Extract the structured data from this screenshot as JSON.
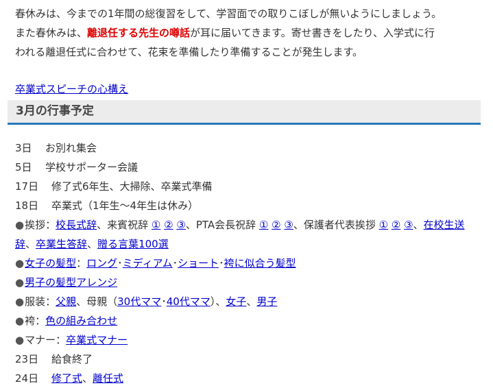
{
  "intro": {
    "line1": "春休みは、今までの1年間の総復習をして、学習面での取りこぼしが無いようにしましょう。",
    "line2_pre": "また春休みは、",
    "line2_em": "離退任する先生の噂話",
    "line2_post": "が耳に届いてきます。寄せ書きをしたり、入学式に行",
    "line3": "われる離退任式に合わせて、花束を準備したり準備することが発生します。"
  },
  "speech_link": "卒業式スピーチの心構え",
  "heading": "3月の行事予定",
  "schedule": {
    "d3": {
      "day": "3日",
      "text": "お別れ集会"
    },
    "d5": {
      "day": "5日",
      "text": "学校サポーター会議"
    },
    "d17": {
      "day": "17日",
      "text": "修了式6年生、大掃除、卒業式準備"
    },
    "d18": {
      "day": "18日",
      "text": "卒業式（1年生～4年生は休み）"
    },
    "greetings": {
      "bullet": "●",
      "label": "挨拶：",
      "principal": "校長式辞",
      "guest": "、来賓祝辞 ",
      "n1": "①",
      "n2": "②",
      "n3": "③",
      "pta": "、PTA会長祝辞 ",
      "parent": "、保護者代表挨拶 ",
      "student_send": "在校生送辞",
      "graduate": "卒業生答辞",
      "words": "贈る言葉100選",
      "comma": "、"
    },
    "girls_hair": {
      "bullet": "●",
      "link": "女子の髪型",
      "colon": "：",
      "long": "ロング",
      "medium": "ミディアム",
      "short": "ショート",
      "hakama": "袴に似合う髪型",
      "dot": "･"
    },
    "boys_hair": {
      "bullet": "●",
      "link": "男子の髪型アレンジ"
    },
    "clothes": {
      "bullet": "●",
      "label": "服装：",
      "father": "父親",
      "mother": "、母親（",
      "m30": "30代ママ",
      "dot": "･",
      "m40": "40代ママ",
      "close": "）、",
      "girls": "女子",
      "comma": "、",
      "boys": "男子"
    },
    "hakama": {
      "bullet": "●",
      "label": "袴：",
      "link": "色の組み合わせ"
    },
    "manners": {
      "bullet": "●",
      "label": "マナー：",
      "link": "卒業式マナー"
    },
    "d23": {
      "day": "23日",
      "text": "給食終了"
    },
    "d24": {
      "day": "24日",
      "link1": "修了式",
      "comma": "、",
      "link2": "離任式"
    }
  },
  "colors": {
    "accent_border": "#2778b9",
    "emphasis": "#dd0000",
    "link": "#0000cc",
    "heading_bg": "#ececec"
  }
}
